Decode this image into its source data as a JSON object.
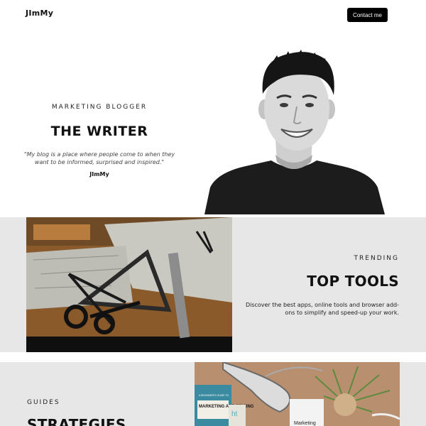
{
  "header": {
    "logo": "JImMy",
    "contact_label": "Contact me"
  },
  "hero": {
    "kicker": "MARKETING BLOGGER",
    "title": "THE WRITER",
    "quote": "\"My blog is a place where people come to when they want to be informed, surprised and inspired.\"",
    "author": "JImMy",
    "image": "portrait-photo"
  },
  "tools": {
    "kicker": "TRENDING",
    "title": "TOP TOOLS",
    "description": "Discover the best apps, online tools and browser add-ons to simplify and speed-up your work.",
    "image": "drafting-tools-photo"
  },
  "strategies": {
    "kicker": "GUIDES",
    "title": "STRATEGIES",
    "image": "desk-flatlay-photo",
    "book_title": "MARKETING AND PRICING",
    "book_kicker": "A BEGINNER'S GUIDE TO",
    "paper_text": "Marketing"
  },
  "colors": {
    "accent": "#000000",
    "section_bg": "#e7e7e7",
    "page_bg": "#ffffff"
  }
}
